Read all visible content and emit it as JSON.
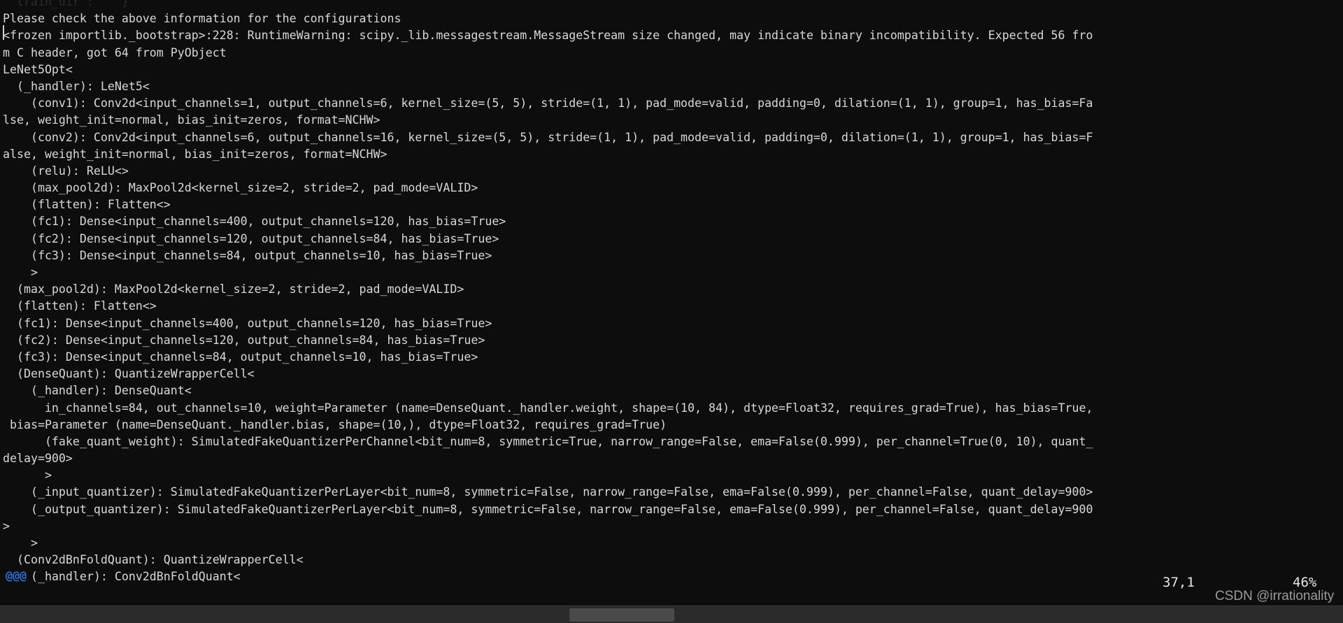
{
  "terminal": {
    "lines": [
      "  train_dir : ' '}",
      "Please check the above information for the configurations",
      "<frozen importlib._bootstrap>:228: RuntimeWarning: scipy._lib.messagestream.MessageStream size changed, may indicate binary incompatibility. Expected 56 fro",
      "m C header, got 64 from PyObject",
      "LeNet5Opt<",
      "  (_handler): LeNet5<",
      "    (conv1): Conv2d<input_channels=1, output_channels=6, kernel_size=(5, 5), stride=(1, 1), pad_mode=valid, padding=0, dilation=(1, 1), group=1, has_bias=Fa",
      "lse, weight_init=normal, bias_init=zeros, format=NCHW>",
      "    (conv2): Conv2d<input_channels=6, output_channels=16, kernel_size=(5, 5), stride=(1, 1), pad_mode=valid, padding=0, dilation=(1, 1), group=1, has_bias=F",
      "alse, weight_init=normal, bias_init=zeros, format=NCHW>",
      "    (relu): ReLU<>",
      "    (max_pool2d): MaxPool2d<kernel_size=2, stride=2, pad_mode=VALID>",
      "    (flatten): Flatten<>",
      "    (fc1): Dense<input_channels=400, output_channels=120, has_bias=True>",
      "    (fc2): Dense<input_channels=120, output_channels=84, has_bias=True>",
      "    (fc3): Dense<input_channels=84, output_channels=10, has_bias=True>",
      "    >",
      "  (max_pool2d): MaxPool2d<kernel_size=2, stride=2, pad_mode=VALID>",
      "  (flatten): Flatten<>",
      "  (fc1): Dense<input_channels=400, output_channels=120, has_bias=True>",
      "  (fc2): Dense<input_channels=120, output_channels=84, has_bias=True>",
      "  (fc3): Dense<input_channels=84, output_channels=10, has_bias=True>",
      "  (DenseQuant): QuantizeWrapperCell<",
      "    (_handler): DenseQuant<",
      "      in_channels=84, out_channels=10, weight=Parameter (name=DenseQuant._handler.weight, shape=(10, 84), dtype=Float32, requires_grad=True), has_bias=True,",
      " bias=Parameter (name=DenseQuant._handler.bias, shape=(10,), dtype=Float32, requires_grad=True)",
      "      (fake_quant_weight): SimulatedFakeQuantizerPerChannel<bit_num=8, symmetric=True, narrow_range=False, ema=False(0.999), per_channel=True(0, 10), quant_",
      "delay=900>",
      "      >",
      "    (_input_quantizer): SimulatedFakeQuantizerPerLayer<bit_num=8, symmetric=False, narrow_range=False, ema=False(0.999), per_channel=False, quant_delay=900>",
      "    (_output_quantizer): SimulatedFakeQuantizerPerLayer<bit_num=8, symmetric=False, narrow_range=False, ema=False(0.999), per_channel=False, quant_delay=900",
      ">",
      "    >",
      "  (Conv2dBnFoldQuant): QuantizeWrapperCell<",
      "    (_handler): Conv2dBnFoldQuant<"
    ],
    "overflow_marker": "@@@",
    "overflow_marker_color": "#2f6fd0",
    "background_color": "#0d0d0d",
    "text_color": "#d8d8d8"
  },
  "status": {
    "cursor_position": "37,1",
    "scroll_percent": "46%",
    "bar_color": "#2a2a2a"
  },
  "watermark": {
    "text": "CSDN @irrationality"
  }
}
